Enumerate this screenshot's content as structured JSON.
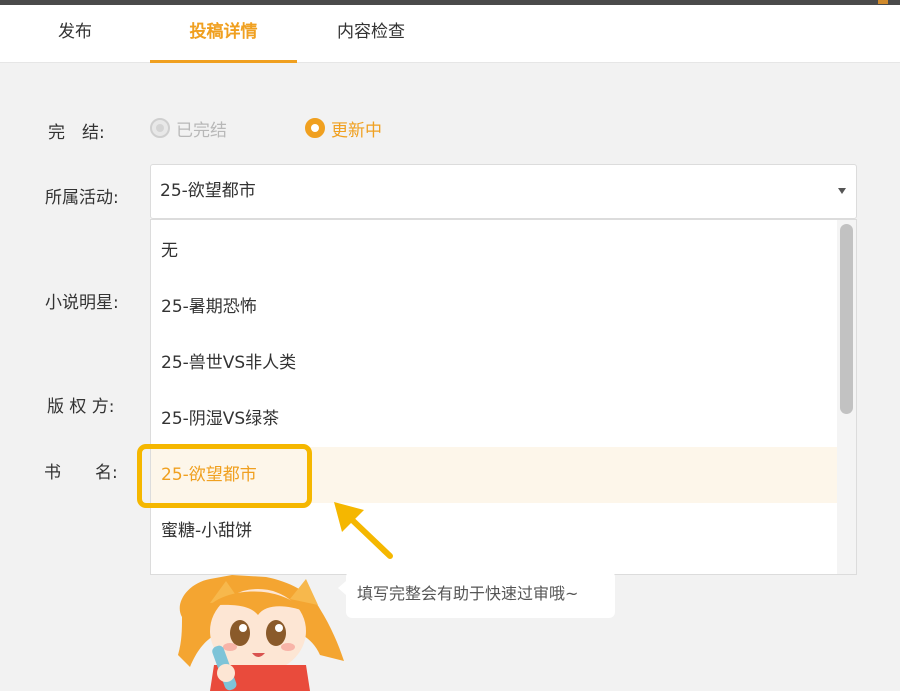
{
  "tabs": [
    {
      "label": "发布"
    },
    {
      "label": "投稿详情"
    },
    {
      "label": "内容检查"
    }
  ],
  "form": {
    "completion_label": "完　结:",
    "completion_options": [
      "已完结",
      "更新中"
    ],
    "completion_selected": "更新中",
    "activity_label": "所属活动:",
    "activity_value": "25-欲望都市",
    "novel_star_label": "小说明星:",
    "copyright_label": "版 权 方:",
    "title_label": "书　　名:"
  },
  "dropdown": {
    "options": [
      "无",
      "25-暑期恐怖",
      "25-兽世VS非人类",
      "25-阴湿VS绿茶",
      "25-欲望都市",
      "蜜糖-小甜饼"
    ],
    "selected": "25-欲望都市"
  },
  "tip": {
    "text": "填写完整会有助于快速过审哦~"
  },
  "colors": {
    "accent": "#f0a020",
    "highlight_box": "#f5b700"
  }
}
